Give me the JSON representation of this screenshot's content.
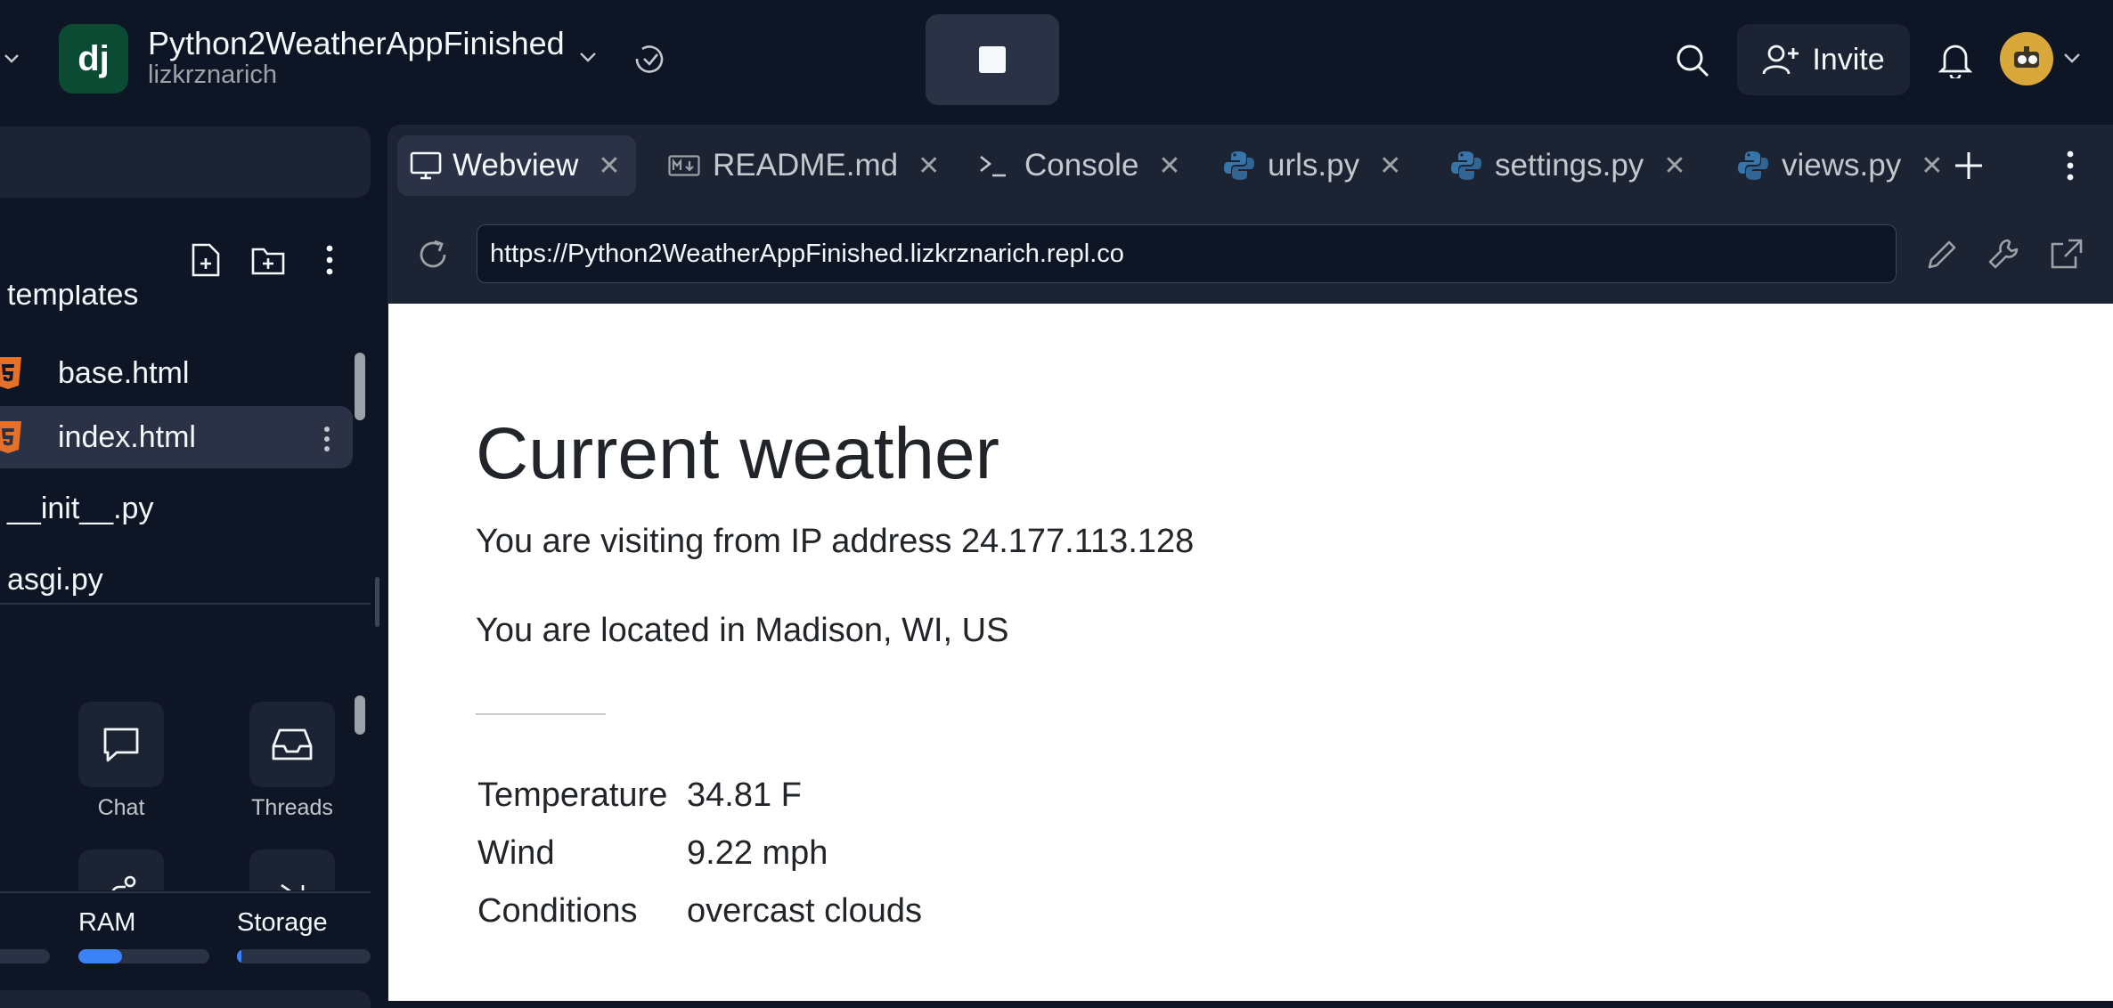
{
  "topbar": {
    "logo_text": "dj",
    "repl_name": "Python2WeatherAppFinished",
    "owner": "lizkrznarich",
    "invite_label": "Invite"
  },
  "sidebar": {
    "folder_label": "templates",
    "files": [
      {
        "name": "base.html",
        "icon": "html5-icon"
      },
      {
        "name": "index.html",
        "icon": "html5-icon",
        "selected": true
      },
      {
        "name": "__init__.py"
      },
      {
        "name": "asgi.py"
      }
    ],
    "tools": [
      {
        "label": "Chat",
        "icon": "chat-icon"
      },
      {
        "label": "Threads",
        "icon": "inbox-icon"
      }
    ],
    "resources": {
      "ram_label": "RAM",
      "storage_label": "Storage",
      "ram_fraction": 0.33,
      "storage_fraction": 0.03
    }
  },
  "tabs": [
    {
      "label": "Webview",
      "icon": "monitor-icon",
      "active": true
    },
    {
      "label": "README.md",
      "icon": "markdown-icon"
    },
    {
      "label": "Console",
      "icon": "terminal-icon"
    },
    {
      "label": "urls.py",
      "icon": "python-icon"
    },
    {
      "label": "settings.py",
      "icon": "python-icon"
    },
    {
      "label": "views.py",
      "icon": "python-icon"
    }
  ],
  "webview": {
    "url": "https://Python2WeatherAppFinished.lizkrznarich.repl.co",
    "title": "Current weather",
    "ip_line": "You are visiting from IP address 24.177.113.128",
    "location_line": "You are located in Madison, WI, US",
    "table": [
      {
        "label": "Temperature",
        "value": "34.81 F"
      },
      {
        "label": "Wind",
        "value": "9.22 mph"
      },
      {
        "label": "Conditions",
        "value": "overcast clouds"
      }
    ]
  },
  "colors": {
    "background": "#0e1525",
    "surface": "#1c2333",
    "surface_hover": "#2b3245",
    "accent_blue": "#3b82f6",
    "django_green": "#0c4b33",
    "html_orange": "#e4702a",
    "python_blue": "#3776ab"
  }
}
